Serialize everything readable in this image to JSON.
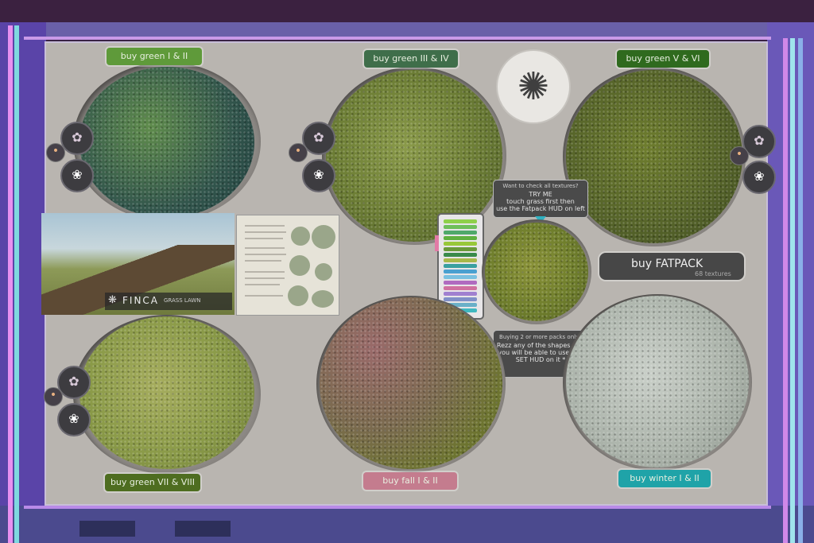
{
  "buttons": {
    "green_1_2": "buy green I & II",
    "green_3_4": "buy green III & IV",
    "green_5_6": "buy green V & VI",
    "green_7_8": "buy green VII & VIII",
    "fall_1_2": "buy fall I & II",
    "winter_1_2": "buy winter I & II",
    "fatpack": "buy FATPACK",
    "fatpack_sub": "68 textures"
  },
  "tooltip_try": {
    "line1": "Want to check all textures?",
    "line2": "TRY ME",
    "line3": "touch grass first then",
    "line4": "use the Fatpack HUD on left"
  },
  "tooltip_buying": {
    "line1": "Buying 2 or more packs only?",
    "line2": "Rezz any of the shapes and",
    "line3": "you will be able to use any",
    "line4": "SET HUD on it *"
  },
  "brand": {
    "name": "FINCA",
    "sub": "GRASS LAWN"
  },
  "colors": {
    "green_1_2": "#5f9a3a",
    "green_3_4": "#3f6e4a",
    "green_5_6": "#2f6a1e",
    "green_7_8": "#4e6d20",
    "fall_1_2": "#c47c8e",
    "winter_1_2": "#1fa3a8"
  },
  "icons": {
    "agave": "agave-plant-icon",
    "hud": "flower-hud-icon"
  }
}
